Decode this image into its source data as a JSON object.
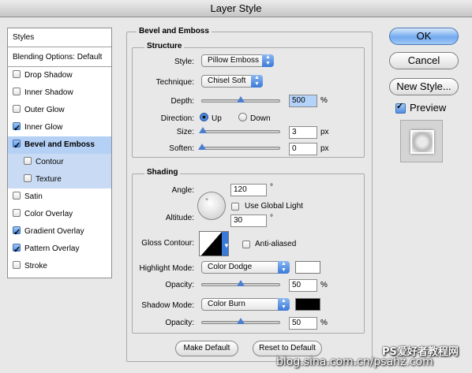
{
  "window": {
    "title": "Layer Style"
  },
  "sidebar": {
    "header": "Styles",
    "items": [
      {
        "label": "Blending Options: Default",
        "checkbox": false,
        "checked": false
      },
      {
        "label": "Drop Shadow",
        "checkbox": true,
        "checked": false
      },
      {
        "label": "Inner Shadow",
        "checkbox": true,
        "checked": false
      },
      {
        "label": "Outer Glow",
        "checkbox": true,
        "checked": false
      },
      {
        "label": "Inner Glow",
        "checkbox": true,
        "checked": true
      },
      {
        "label": "Bevel and Emboss",
        "checkbox": true,
        "checked": true,
        "selected": true
      },
      {
        "label": "Contour",
        "checkbox": true,
        "checked": false,
        "sub": true
      },
      {
        "label": "Texture",
        "checkbox": true,
        "checked": false,
        "sub": true
      },
      {
        "label": "Satin",
        "checkbox": true,
        "checked": false
      },
      {
        "label": "Color Overlay",
        "checkbox": true,
        "checked": false
      },
      {
        "label": "Gradient Overlay",
        "checkbox": true,
        "checked": true
      },
      {
        "label": "Pattern Overlay",
        "checkbox": true,
        "checked": true
      },
      {
        "label": "Stroke",
        "checkbox": true,
        "checked": false
      }
    ]
  },
  "bevel": {
    "title": "Bevel and Emboss",
    "structure": {
      "title": "Structure",
      "style_label": "Style:",
      "style_value": "Pillow Emboss",
      "technique_label": "Technique:",
      "technique_value": "Chisel Soft",
      "depth_label": "Depth:",
      "depth_value": "500",
      "depth_unit": "%",
      "depth_level": 0.5,
      "direction_label": "Direction:",
      "up_label": "Up",
      "down_label": "Down",
      "size_label": "Size:",
      "size_value": "3",
      "size_unit": "px",
      "size_level": 0.01,
      "soften_label": "Soften:",
      "soften_value": "0",
      "soften_unit": "px",
      "soften_level": 0.0
    },
    "shading": {
      "title": "Shading",
      "angle_label": "Angle:",
      "angle_value": "120",
      "angle_unit": "°",
      "global_light_label": "Use Global Light",
      "altitude_label": "Altitude:",
      "altitude_value": "30",
      "altitude_unit": "°",
      "gloss_label": "Gloss Contour:",
      "antialiased_label": "Anti-aliased",
      "highlight_label": "Highlight Mode:",
      "highlight_value": "Color Dodge",
      "highlight_color": "#ffffff",
      "highlight_opacity_label": "Opacity:",
      "highlight_opacity_value": "50",
      "highlight_opacity_unit": "%",
      "highlight_opacity_level": 0.5,
      "shadow_label": "Shadow Mode:",
      "shadow_value": "Color Burn",
      "shadow_color": "#000000",
      "shadow_opacity_label": "Opacity:",
      "shadow_opacity_value": "50",
      "shadow_opacity_unit": "%",
      "shadow_opacity_level": 0.5
    },
    "make_default": "Make Default",
    "reset_default": "Reset to Default"
  },
  "buttons": {
    "ok": "OK",
    "cancel": "Cancel",
    "new_style": "New Style...",
    "preview": "Preview"
  },
  "watermark": {
    "line1": "PS爱好者教程网",
    "line2": "blog.sina.com.cn/psahz.com"
  }
}
